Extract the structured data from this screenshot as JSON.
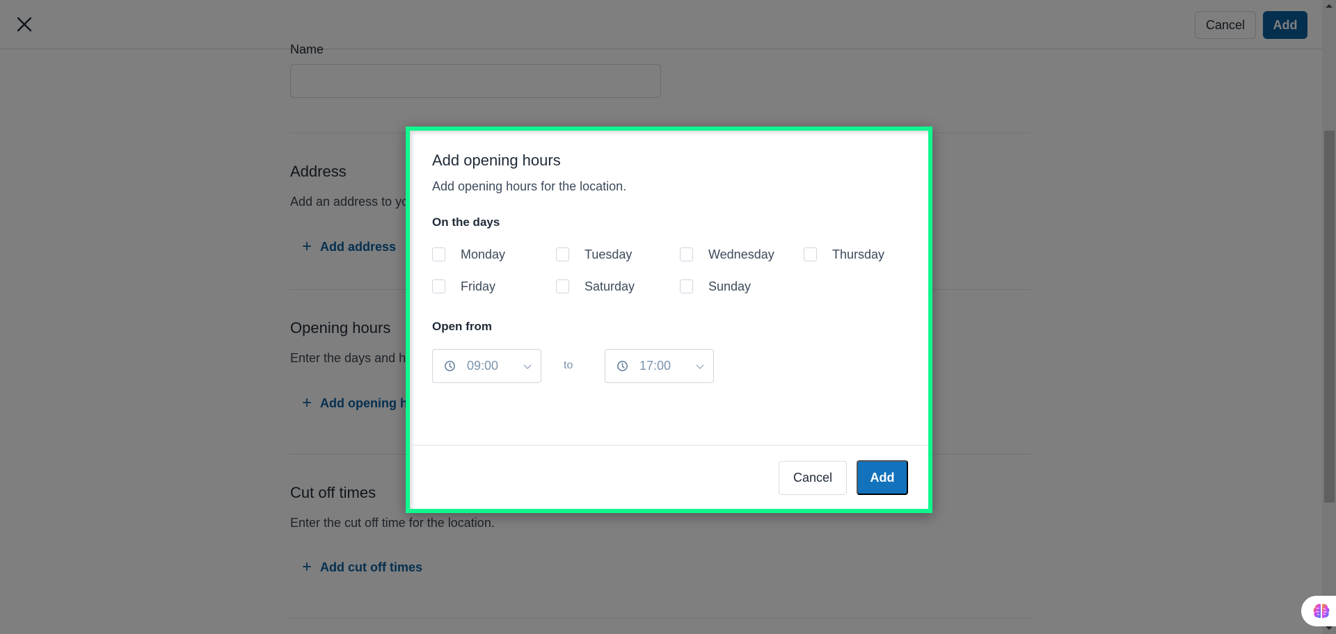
{
  "topbar": {
    "close_icon": "close-icon",
    "cancel_label": "Cancel",
    "add_label": "Add"
  },
  "form": {
    "name_label": "Name",
    "name_value": "",
    "sections": [
      {
        "title": "Address",
        "description": "Add an address to your location.",
        "link": "Add address"
      },
      {
        "title": "Opening hours",
        "description": "Enter the days and hours the location is open.",
        "link": "Add opening hours"
      },
      {
        "title": "Cut off times",
        "description": "Enter the cut off time for the location.",
        "link": "Add cut off times"
      }
    ]
  },
  "dialog": {
    "title": "Add opening hours",
    "description": "Add opening hours for the location.",
    "days_label": "On the days",
    "days": [
      {
        "label": "Monday",
        "checked": false
      },
      {
        "label": "Tuesday",
        "checked": false
      },
      {
        "label": "Wednesday",
        "checked": false
      },
      {
        "label": "Thursday",
        "checked": false
      },
      {
        "label": "Friday",
        "checked": false
      },
      {
        "label": "Saturday",
        "checked": false
      },
      {
        "label": "Sunday",
        "checked": false
      }
    ],
    "open_from_label": "Open from",
    "from_time": "09:00",
    "to_label": "to",
    "to_time": "17:00",
    "cancel_label": "Cancel",
    "add_label": "Add"
  },
  "colors": {
    "primary": "#1272bb",
    "link": "#0b5f9e",
    "highlight_border": "#10f78f"
  }
}
